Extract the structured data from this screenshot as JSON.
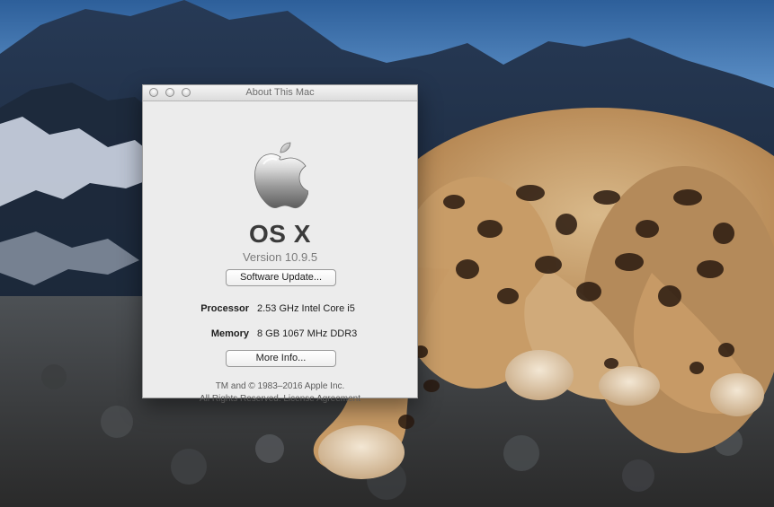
{
  "window": {
    "title": "About This Mac"
  },
  "about": {
    "os_name": "OS X",
    "version_text": "Version 10.9.5",
    "software_update_label": "Software Update...",
    "specs": [
      {
        "label": "Processor",
        "value": "2.53 GHz Intel Core i5"
      },
      {
        "label": "Memory",
        "value": "8 GB 1067 MHz DDR3"
      }
    ],
    "more_info_label": "More Info...",
    "copyright": "TM and © 1983–2016 Apple Inc.",
    "rights": "All Rights Reserved.",
    "license_link": "License Agreement"
  },
  "icons": {
    "logo": "apple-logo-icon",
    "close": "close-button-icon",
    "minimize": "minimize-button-icon",
    "zoom": "zoom-button-icon"
  },
  "colors": {
    "window_bg": "#ececec",
    "title_text": "#6d6d6d",
    "heading_text": "#3b3b3b"
  }
}
